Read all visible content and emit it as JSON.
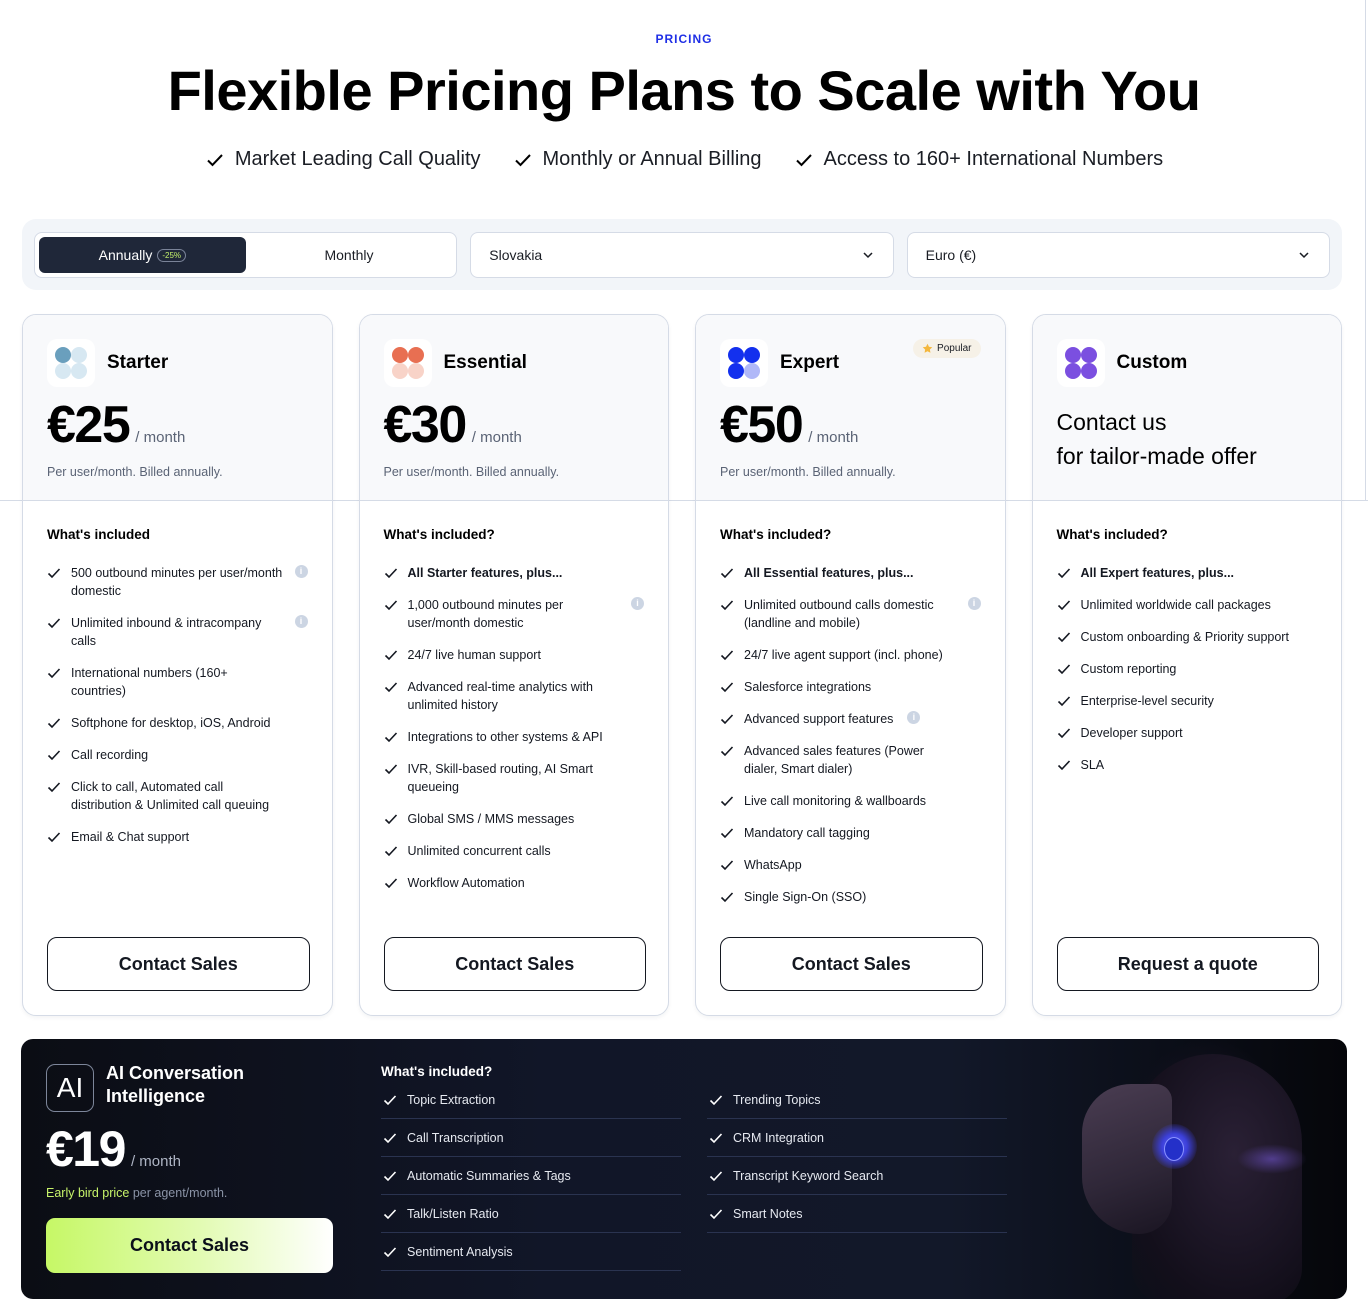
{
  "header": {
    "eyebrow": "PRICING",
    "title": "Flexible Pricing Plans to Scale with You",
    "bullets": [
      "Market Leading Call Quality",
      "Monthly or Annual Billing",
      "Access to 160+ International Numbers"
    ]
  },
  "controls": {
    "billing": {
      "options": [
        "Annually",
        "Monthly"
      ],
      "selected": "Annually",
      "discount_badge": "-25%"
    },
    "country": {
      "value": "Slovakia"
    },
    "currency": {
      "value": "Euro (€)"
    }
  },
  "plans": [
    {
      "name": "Starter",
      "icon": "starter-dots-icon",
      "colors": [
        "#6a9fbd",
        "#d7e8f2",
        "#d7e8f2",
        "#d7e8f2"
      ],
      "price": "€25",
      "period": "/ month",
      "billed": "Per user/month. Billed annually.",
      "included_title": "What's included",
      "features": [
        {
          "text": "500 outbound minutes per user/month domestic",
          "info": true
        },
        {
          "text": "Unlimited inbound & intracompany calls",
          "info": true
        },
        {
          "text": "International numbers (160+ countries)"
        },
        {
          "text": "Softphone for desktop, iOS, Android"
        },
        {
          "text": "Call recording"
        },
        {
          "text": "Click to call, Automated call distribution & Unlimited call queuing"
        },
        {
          "text": "Email & Chat support"
        }
      ],
      "cta": "Contact Sales"
    },
    {
      "name": "Essential",
      "icon": "essential-dots-icon",
      "colors": [
        "#e86f52",
        "#e86f52",
        "#f8d3c8",
        "#f8d3c8"
      ],
      "price": "€30",
      "period": "/ month",
      "billed": "Per user/month. Billed annually.",
      "included_title": "What's included?",
      "features": [
        {
          "text": "All Starter features, plus...",
          "bold": true
        },
        {
          "text": "1,000 outbound minutes per user/month domestic",
          "info": true
        },
        {
          "text": "24/7 live human support"
        },
        {
          "text": "Advanced real-time analytics with unlimited history"
        },
        {
          "text": "Integrations to other systems & API"
        },
        {
          "text": "IVR, Skill-based routing, AI Smart queueing"
        },
        {
          "text": "Global SMS / MMS messages"
        },
        {
          "text": "Unlimited concurrent calls"
        },
        {
          "text": "Workflow Automation"
        }
      ],
      "cta": "Contact Sales"
    },
    {
      "name": "Expert",
      "icon": "expert-dots-icon",
      "colors": [
        "#1330ee",
        "#1330ee",
        "#1330ee",
        "#b0b8f8"
      ],
      "badge": "Popular",
      "price": "€50",
      "period": "/ month",
      "billed": "Per user/month. Billed annually.",
      "included_title": "What's included?",
      "features": [
        {
          "text": "All Essential features, plus...",
          "bold": true
        },
        {
          "text": "Unlimited outbound calls domestic (landline and mobile)",
          "info": true
        },
        {
          "text": "24/7 live agent support (incl. phone)"
        },
        {
          "text": "Salesforce integrations"
        },
        {
          "text": "Advanced support features",
          "info_inline": true
        },
        {
          "text": "Advanced sales features (Power dialer, Smart dialer)"
        },
        {
          "text": "Live call monitoring & wallboards"
        },
        {
          "text": "Mandatory call tagging"
        },
        {
          "text": "WhatsApp"
        },
        {
          "text": "Single Sign-On (SSO)"
        }
      ],
      "cta": "Contact Sales"
    },
    {
      "name": "Custom",
      "icon": "custom-dots-icon",
      "colors": [
        "#7b4fe0",
        "#7b4fe0",
        "#7b4fe0",
        "#7b4fe0"
      ],
      "contact_line1": "Contact us",
      "contact_line2": "for tailor-made offer",
      "included_title": "What's included?",
      "features": [
        {
          "text": "All Expert features, plus...",
          "bold": true
        },
        {
          "text": "Unlimited worldwide call packages"
        },
        {
          "text": "Custom onboarding & Priority support"
        },
        {
          "text": "Custom reporting"
        },
        {
          "text": "Enterprise-level security"
        },
        {
          "text": "Developer support"
        },
        {
          "text": "SLA"
        }
      ],
      "cta": "Request a quote"
    }
  ],
  "ai": {
    "logo": "AI",
    "title_line1": "AI Conversation",
    "title_line2": "Intelligence",
    "price": "€19",
    "period": "/ month",
    "note_highlight": "Early bird price",
    "note_rest": "per agent/month.",
    "cta": "Contact Sales",
    "included_title": "What's included?",
    "features_col1": [
      "Topic Extraction",
      "Call Transcription",
      "Automatic Summaries & Tags",
      "Talk/Listen Ratio",
      "Sentiment Analysis"
    ],
    "features_col2": [
      "Trending Topics",
      "CRM Integration",
      "Transcript Keyword Search",
      "Smart Notes"
    ],
    "accent": "#c7f36a"
  }
}
